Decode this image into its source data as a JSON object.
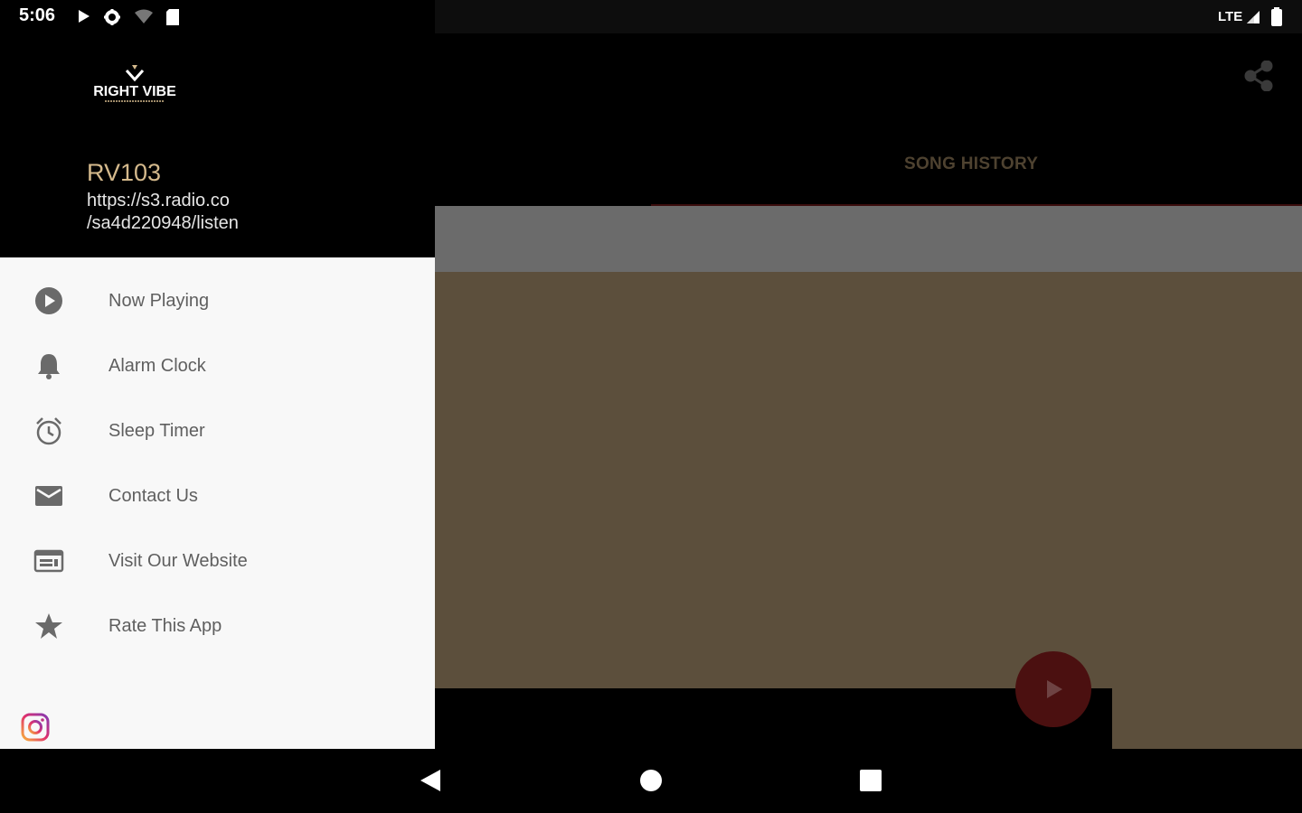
{
  "status_bar": {
    "time": "5:06",
    "network": "LTE"
  },
  "drawer": {
    "logo_text": "RIGHT VIBE",
    "station_name": "RV103",
    "station_url_line1": "https://s3.radio.co",
    "station_url_line2": "/sa4d220948/listen",
    "items": [
      {
        "label": "Now Playing",
        "icon": "play-circle-icon"
      },
      {
        "label": "Alarm Clock",
        "icon": "bell-icon"
      },
      {
        "label": "Sleep Timer",
        "icon": "alarm-clock-icon"
      },
      {
        "label": "Contact Us",
        "icon": "envelope-icon"
      },
      {
        "label": "Visit Our Website",
        "icon": "web-icon"
      },
      {
        "label": "Rate This App",
        "icon": "star-icon"
      }
    ],
    "social": {
      "icon": "instagram-icon"
    }
  },
  "main": {
    "tab_label": "SONG HISTORY",
    "colors": {
      "accent": "#d4b98c",
      "content_bg": "#5c4f3c",
      "fab": "#4b1010"
    }
  },
  "nav": {
    "back": "back-icon",
    "home": "home-icon",
    "recents": "recents-icon"
  }
}
